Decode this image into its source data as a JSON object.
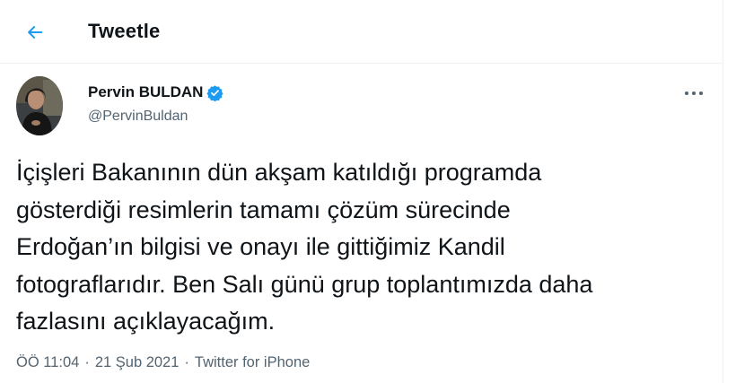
{
  "header": {
    "title": "Tweetle",
    "back_icon": "arrow-left-icon"
  },
  "author": {
    "display_name": "Pervin BULDAN",
    "handle": "@PervinBuldan",
    "verified": true
  },
  "tweet": {
    "text": "İçişleri Bakanının dün akşam katıldığı programda\ngösterdiği resimlerin tamamı çözüm sürecinde\nErdoğan’ın bilgisi ve onayı ile gittiğimiz Kandil\nfotograflarıdır. Ben Salı günü grup toplantımızda daha\nfazlasını açıklayacağım."
  },
  "meta": {
    "time": "ÖÖ 11:04",
    "date": "21 Şub 2021",
    "source": "Twitter for iPhone",
    "separator": "·"
  },
  "colors": {
    "accent": "#1d9bf0",
    "text_primary": "#0f1419",
    "text_secondary": "#536471",
    "border": "#eff3f4"
  }
}
